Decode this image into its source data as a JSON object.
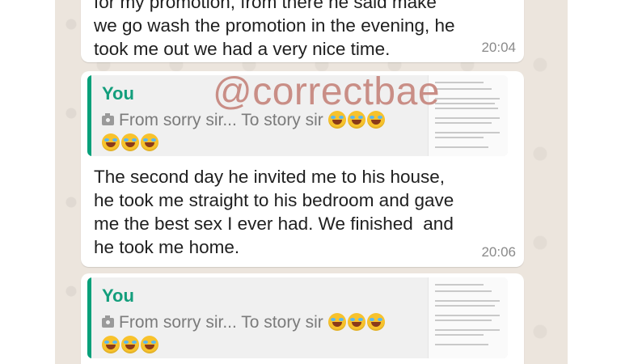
{
  "messages": [
    {
      "text": "for my promotion, from there he said make\nwe go wash the promotion in the evening, he\ntook me out we had a very nice time.",
      "time": "20:04"
    },
    {
      "quote": {
        "sender": "You",
        "text": "From sorry sir... To story sir"
      },
      "text": "The second day he invited me to his house,\nhe took me straight to his bedroom and gave\nme the best sex I ever had. We finished  and\nhe took me home.",
      "time": "20:06"
    },
    {
      "quote": {
        "sender": "You",
        "text": "From sorry sir... To story sir"
      }
    }
  ],
  "watermark": "@correctbae",
  "icons": {
    "quote_media": "camera-icon",
    "emoji": "rolling-on-floor-laughing-emoji"
  },
  "colors": {
    "chat_background": "#ece5dd",
    "quote_accent": "#06a07a",
    "watermark": "#c98e86"
  }
}
